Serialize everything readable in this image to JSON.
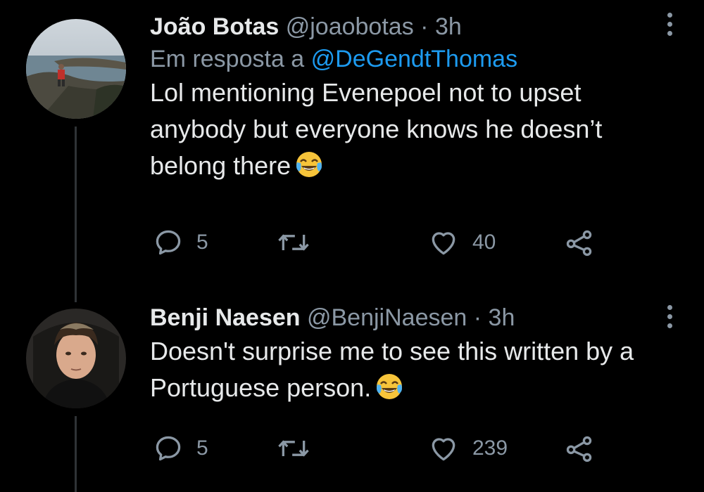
{
  "colors": {
    "background": "#000000",
    "primary_text": "#e7e9ea",
    "secondary_text": "#8b98a5",
    "mention": "#1d9bf0",
    "thread_line": "#2f3336"
  },
  "tweets": [
    {
      "author_name": "João Botas",
      "handle": "@joaobotas",
      "separator": "·",
      "time": "3h",
      "reply_prefix": "Em resposta a",
      "reply_mention": "@DeGendtThomas",
      "text": "Lol mentioning Evenepoel not to upset anybody but everyone knows he doesn’t belong there",
      "emoji": "face-with-tears-of-joy",
      "replies": "5",
      "retweets": "",
      "likes": "40",
      "icons": [
        "reply-icon",
        "retweet-icon",
        "like-icon",
        "share-icon",
        "more-icon"
      ]
    },
    {
      "author_name": "Benji Naesen",
      "handle": "@BenjiNaesen",
      "separator": "·",
      "time": "3h",
      "text": "Doesn't surprise me to see this written by a Portuguese person.",
      "emoji": "face-with-tears-of-joy",
      "replies": "5",
      "retweets": "",
      "likes": "239",
      "icons": [
        "reply-icon",
        "retweet-icon",
        "like-icon",
        "share-icon",
        "more-icon"
      ]
    }
  ]
}
